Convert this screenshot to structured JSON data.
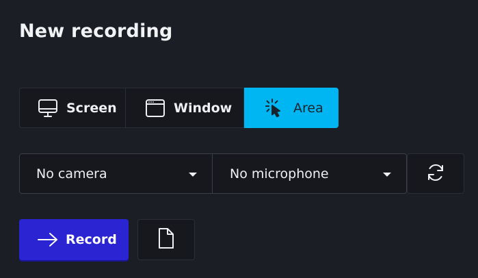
{
  "title": "New recording",
  "source_types": [
    {
      "label": "Screen",
      "icon": "monitor-icon",
      "selected": false
    },
    {
      "label": "Window",
      "icon": "window-icon",
      "selected": false
    },
    {
      "label": "Area",
      "icon": "area-select-cursor-icon",
      "selected": true
    }
  ],
  "devices": {
    "camera": {
      "value": "No camera",
      "icon": "chevron-down-icon"
    },
    "microphone": {
      "value": "No microphone",
      "icon": "chevron-down-icon"
    },
    "refresh_icon": "refresh-icon"
  },
  "actions": {
    "record_label": "Record",
    "record_icon": "arrow-right-icon",
    "file_icon": "file-icon"
  },
  "colors": {
    "background": "#1b1e25",
    "selected_accent": "#00b6f2",
    "record_button": "#2b24d3"
  }
}
